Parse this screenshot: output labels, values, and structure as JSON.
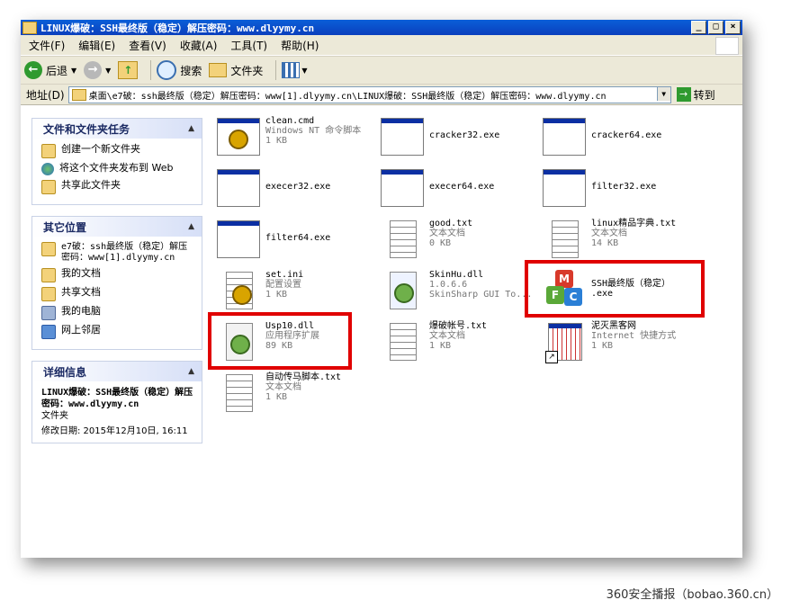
{
  "window": {
    "title": "LINUX爆破：SSH最终版（稳定）解压密码：www.dlyymy.cn",
    "controls": {
      "minimize": "_",
      "maximize": "□",
      "close": "×"
    }
  },
  "menu": [
    "文件(F)",
    "编辑(E)",
    "查看(V)",
    "收藏(A)",
    "工具(T)",
    "帮助(H)"
  ],
  "toolbar": {
    "back": "后退",
    "search": "搜索",
    "folders": "文件夹"
  },
  "address": {
    "label": "地址(D)",
    "value": "桌面\\e7破：ssh最终版（稳定）解压密码：www[1].dlyymy.cn\\LINUX爆破：SSH最终版（稳定）解压密码：www.dlyymy.cn",
    "go": "转到"
  },
  "tasks": {
    "title": "文件和文件夹任务",
    "items": [
      "创建一个新文件夹",
      "将这个文件夹发布到 Web",
      "共享此文件夹"
    ]
  },
  "places": {
    "title": "其它位置",
    "items": [
      "e7破：ssh最终版（稳定）解压密码：www[1].dlyymy.cn",
      "我的文档",
      "共享文档",
      "我的电脑",
      "网上邻居"
    ]
  },
  "details": {
    "title": "详细信息",
    "name": "LINUX爆破：SSH最终版（稳定）解压密码：www.dlyymy.cn",
    "type": "文件夹",
    "modified": "修改日期: 2015年12月10日, 16:11"
  },
  "files": [
    {
      "name": "clean.cmd",
      "line2": "Windows NT 命令脚本",
      "line3": "1 KB",
      "icon": "cmd-icon"
    },
    {
      "name": "cracker32.exe",
      "line2": "",
      "line3": "",
      "icon": "exe-icon"
    },
    {
      "name": "cracker64.exe",
      "line2": "",
      "line3": "",
      "icon": "exe-icon"
    },
    {
      "name": "execer32.exe",
      "line2": "",
      "line3": "",
      "icon": "exe-icon"
    },
    {
      "name": "execer64.exe",
      "line2": "",
      "line3": "",
      "icon": "exe-icon"
    },
    {
      "name": "filter32.exe",
      "line2": "",
      "line3": "",
      "icon": "exe-icon"
    },
    {
      "name": "filter64.exe",
      "line2": "",
      "line3": "",
      "icon": "exe-icon"
    },
    {
      "name": "good.txt",
      "line2": "文本文档",
      "line3": "0 KB",
      "icon": "txt-icon"
    },
    {
      "name": "linux精品字典.txt",
      "line2": "文本文档",
      "line3": "14 KB",
      "icon": "txt-icon"
    },
    {
      "name": "set.ini",
      "line2": "配置设置",
      "line3": "1 KB",
      "icon": "ini-icon"
    },
    {
      "name": "SkinHu.dll",
      "line2": "1.0.6.6",
      "line3": "SkinSharp GUI To...",
      "icon": "dll-icon"
    },
    {
      "name": "SSH最终版（稳定）",
      "line2": ".exe",
      "line3": "",
      "icon": "mfc-icon"
    },
    {
      "name": "Usp10.dll",
      "line2": "应用程序扩展",
      "line3": "89 KB",
      "icon": "dll-icon"
    },
    {
      "name": "爆破帐号.txt",
      "line2": "文本文档",
      "line3": "1 KB",
      "icon": "txt-icon"
    },
    {
      "name": "泥灭黑客网",
      "line2": "Internet 快捷方式",
      "line3": "1 KB",
      "icon": "shortcut-icon"
    },
    {
      "name": "自动传马脚本.txt",
      "line2": "文本文档",
      "line3": "1 KB",
      "icon": "txt-icon"
    }
  ],
  "watermark": "360安全播报（bobao.360.cn）"
}
